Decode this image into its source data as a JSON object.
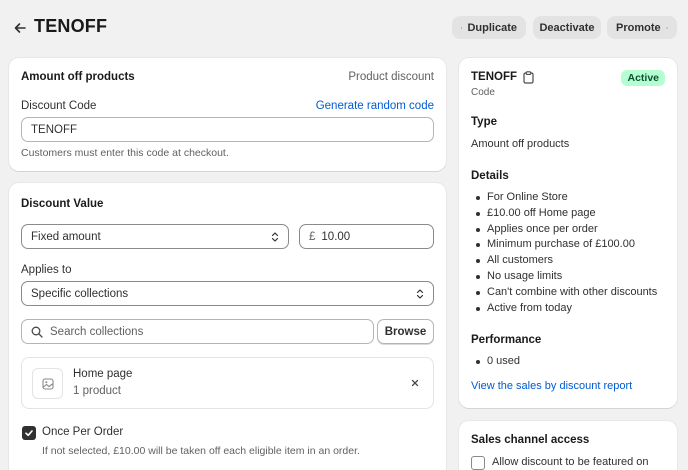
{
  "header": {
    "title": "TENOFF",
    "duplicate_label": "Duplicate",
    "deactivate_label": "Deactivate",
    "promote_label": "Promote"
  },
  "code_card": {
    "title": "Amount off products",
    "type_label": "Product discount",
    "code_label": "Discount Code",
    "generate_label": "Generate random code",
    "code_value": "TENOFF",
    "help": "Customers must enter this code at checkout."
  },
  "value_card": {
    "title": "Discount Value",
    "value_type": "Fixed amount",
    "currency": "£",
    "amount": "10.00",
    "applies_label": "Applies to",
    "applies_value": "Specific collections",
    "search_placeholder": "Search collections",
    "browse_label": "Browse",
    "collection": {
      "name": "Home page",
      "count": "1 product"
    },
    "once_label": "Once Per Order",
    "once_checked": true,
    "once_help": "If not selected, £10.00 will be taken off each eligible item in an order."
  },
  "summary": {
    "code": "TENOFF",
    "code_sub": "Code",
    "status": "Active",
    "type_heading": "Type",
    "type_value": "Amount off products",
    "details_heading": "Details",
    "details": [
      "For Online Store",
      "£10.00 off Home page",
      "Applies once per order",
      "Minimum purchase of £100.00",
      "All customers",
      "No usage limits",
      "Can't combine with other discounts",
      "Active from today"
    ],
    "performance_heading": "Performance",
    "performance": [
      "0 used"
    ],
    "report_link": "View the sales by discount report"
  },
  "sales_channel": {
    "title": "Sales channel access",
    "option_label": "Allow discount to be featured on"
  },
  "colors": {
    "accent": "#005bd3",
    "active_badge_bg": "#b4fed2",
    "active_badge_text": "#0c5132",
    "checkbox": "#303030"
  }
}
